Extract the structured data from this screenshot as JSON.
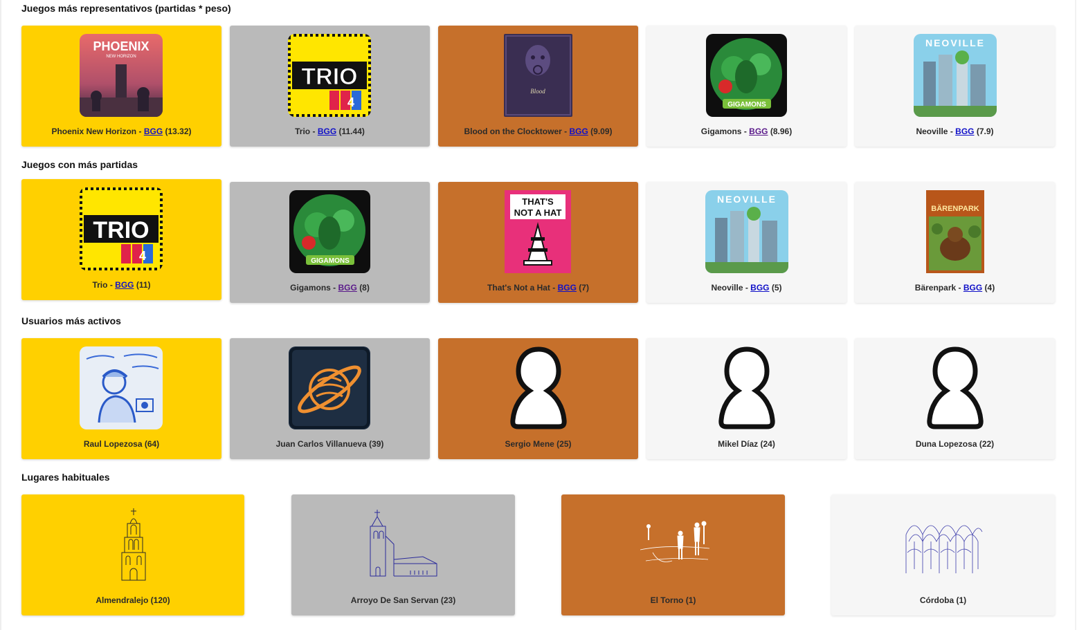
{
  "sections": {
    "representative": {
      "title": "Juegos más representativos (partidas * peso)",
      "cards": [
        {
          "name": "Phoenix New Horizon",
          "link": "BGG",
          "value": "(13.32)"
        },
        {
          "name": "Trio",
          "link": "BGG",
          "value": "(11.44)"
        },
        {
          "name": "Blood on the Clocktower",
          "link": "BGG",
          "value": "(9.09)"
        },
        {
          "name": "Gigamons",
          "link": "BGG",
          "value": "(8.96)"
        },
        {
          "name": "Neoville",
          "link": "BGG",
          "value": "(7.9)"
        }
      ]
    },
    "most_played": {
      "title": "Juegos con más partidas",
      "cards": [
        {
          "name": "Trio",
          "link": "BGG",
          "value": "(11)"
        },
        {
          "name": "Gigamons",
          "link": "BGG",
          "value": "(8)"
        },
        {
          "name": "That's Not a Hat",
          "link": "BGG",
          "value": "(7)"
        },
        {
          "name": "Neoville",
          "link": "BGG",
          "value": "(5)"
        },
        {
          "name": "Bärenpark",
          "link": "BGG",
          "value": "(4)"
        }
      ]
    },
    "users": {
      "title": "Usuarios más activos",
      "cards": [
        {
          "label": "Raul Lopezosa (64)"
        },
        {
          "label": "Juan Carlos Villanueva (39)"
        },
        {
          "label": "Sergio Mene (25)"
        },
        {
          "label": "Mikel Díaz (24)"
        },
        {
          "label": "Duna Lopezosa (22)"
        }
      ]
    },
    "places": {
      "title": "Lugares habituales",
      "cards": [
        {
          "label": "Almendralejo (120)"
        },
        {
          "label": "Arroyo De San Servan (23)"
        },
        {
          "label": "El Torno (1)"
        },
        {
          "label": "Córdoba (1)"
        }
      ]
    }
  },
  "cover_art": {
    "phoenix": {
      "line1": "PHOENIX",
      "line2": "NEW HORIZON"
    },
    "trio": {
      "text": "TRIO"
    },
    "gigamons": {
      "text": "GIGAMONS"
    },
    "neoville": {
      "text": "NEOVILLE"
    },
    "hat": {
      "line1": "THAT'S",
      "line2": "NOT A HAT"
    },
    "barenpark": {
      "text": "BÄRENPARK"
    }
  },
  "colors": {
    "gold": "#ffd000",
    "silver": "#bababa",
    "bronze": "#c6702b",
    "plain": "#f6f6f6",
    "link": "#1010c8"
  }
}
